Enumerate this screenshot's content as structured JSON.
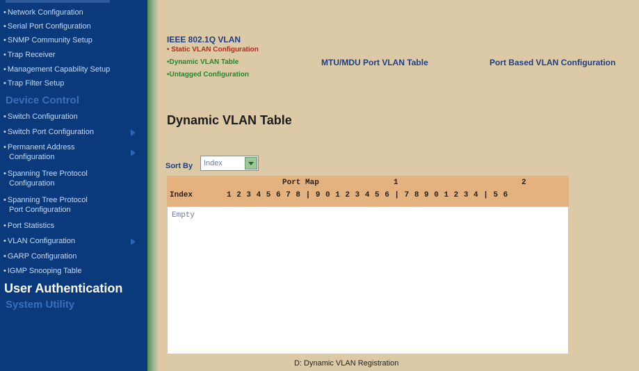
{
  "sidebar": {
    "items": [
      {
        "label": "Network Configuration"
      },
      {
        "label": "Serial Port Configuration"
      },
      {
        "label": "SNMP Community Setup"
      },
      {
        "label": "Trap Receiver"
      },
      {
        "label": "Management Capability Setup"
      },
      {
        "label": "Trap Filter Setup"
      }
    ],
    "heading_device": "Device Control",
    "device_items": [
      {
        "label": "Switch Configuration"
      },
      {
        "label": "Switch Port Configuration"
      },
      {
        "label_1": "Permanent Address",
        "label_2": "Configuration"
      },
      {
        "label_1": "Spanning Tree Protocol",
        "label_2": "Configuration"
      },
      {
        "label_1": "Spanning Tree Protocol",
        "label_2": "Port Configuration"
      },
      {
        "label": "Port Statistics"
      },
      {
        "label": "VLAN Configuration"
      },
      {
        "label": "GARP Configuration"
      },
      {
        "label": "IGMP Snooping Table"
      }
    ],
    "heading_user_auth": "User Authentication",
    "heading_system": "System Utility"
  },
  "vlan_nav": {
    "title": "IEEE 802.1Q VLAN",
    "links": [
      {
        "label": "Static VLAN Configuration"
      },
      {
        "label": "Dynamic VLAN Table"
      },
      {
        "label": "Untagged Configuration"
      }
    ],
    "mtu_link": "MTU/MDU Port VLAN Table",
    "port_based_link": "Port Based VLAN Configuration"
  },
  "page": {
    "title": "Dynamic VLAN Table",
    "sort_label": "Sort By",
    "sort_value": "Index"
  },
  "table": {
    "port_map_label": "Port Map",
    "tens_1": "1",
    "tens_2": "2",
    "index_label": "Index",
    "port_digits": "1 2 3 4 5 6 7 8 | 9 0 1 2 3 4 5 6 | 7 8 9 0 1 2 3 4 | 5 6",
    "empty_text": "Empty"
  },
  "caption": "D: Dynamic VLAN Registration",
  "colors": {
    "sidebar_bg": "#0a3a7c",
    "main_bg": "#dcc9a6",
    "table_header_bg": "#e4b27f",
    "link_red": "#b8281c",
    "link_green": "#1f8a2a",
    "link_blue": "#1e3e84"
  }
}
